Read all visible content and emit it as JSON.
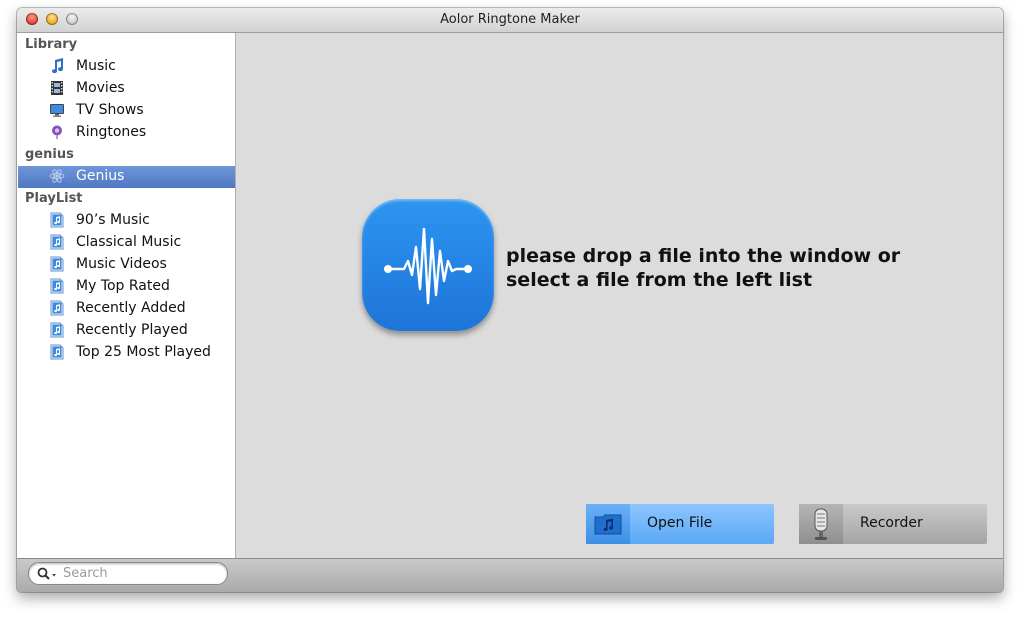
{
  "window": {
    "title": "Aolor Ringtone Maker"
  },
  "sidebar": {
    "library": {
      "header": "Library",
      "items": [
        {
          "label": "Music",
          "icon": "music-note-icon"
        },
        {
          "label": "Movies",
          "icon": "film-icon"
        },
        {
          "label": "TV Shows",
          "icon": "tv-icon"
        },
        {
          "label": "Ringtones",
          "icon": "ringtone-bell-icon"
        }
      ]
    },
    "genius": {
      "header": "genius",
      "items": [
        {
          "label": "Genius",
          "icon": "genius-atom-icon",
          "selected": true
        }
      ]
    },
    "playlist": {
      "header": "PlayList",
      "items": [
        {
          "label": "90’s Music",
          "icon": "playlist-icon"
        },
        {
          "label": "Classical Music",
          "icon": "playlist-icon"
        },
        {
          "label": "Music Videos",
          "icon": "playlist-icon"
        },
        {
          "label": "My Top Rated",
          "icon": "playlist-icon"
        },
        {
          "label": "Recently Added",
          "icon": "playlist-icon"
        },
        {
          "label": "Recently Played",
          "icon": "playlist-icon"
        },
        {
          "label": "Top 25 Most Played",
          "icon": "playlist-icon"
        }
      ]
    }
  },
  "main": {
    "drop_message_line1": "please drop a file into the window or",
    "drop_message_line2": "select a file from the left list",
    "open_file_label": "Open File",
    "recorder_label": "Recorder"
  },
  "search": {
    "placeholder": "Search"
  },
  "colors": {
    "accent": "#1E74D8",
    "selection": "#5A82C8",
    "open_button": "#6FB4F8"
  }
}
